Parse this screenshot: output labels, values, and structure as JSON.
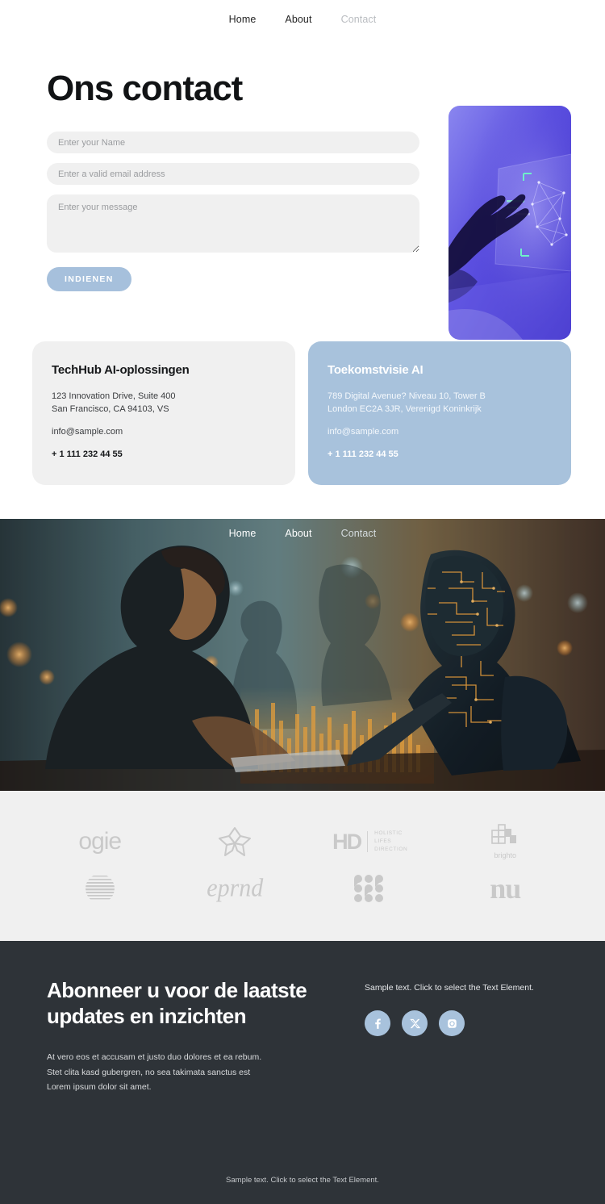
{
  "top_nav": {
    "items": [
      {
        "label": "Home",
        "state": "normal"
      },
      {
        "label": "About",
        "state": "normal"
      },
      {
        "label": "Contact",
        "state": "muted"
      }
    ]
  },
  "contact": {
    "title": "Ons contact",
    "form": {
      "name_placeholder": "Enter your Name",
      "name_value": "",
      "email_placeholder": "Enter a valid email address",
      "email_value": "",
      "message_placeholder": "Enter your message",
      "message_value": "",
      "submit_label": "INDIENEN"
    },
    "hero_image_alt": "hand-touching-holographic-interface"
  },
  "cards": [
    {
      "title": "TechHub AI-oplossingen",
      "address_line1": "123 Innovation Drive, Suite 400",
      "address_line2": "San Francisco, CA 94103, VS",
      "email": "info@sample.com",
      "phone": "+ 1 111 232 44 55",
      "style": "light"
    },
    {
      "title": "Toekomstvisie AI",
      "address_line1": "789 Digital Avenue? Niveau 10, Tower B",
      "address_line2": "London EC2A 3JR, Verenigd Koninkrijk",
      "email": "info@sample.com",
      "phone": "+ 1 111 232 44 55",
      "style": "blue"
    }
  ],
  "banner": {
    "nav": [
      {
        "label": "Home",
        "state": "normal"
      },
      {
        "label": "About",
        "state": "normal"
      },
      {
        "label": "Contact",
        "state": "muted"
      }
    ],
    "image_alt": "woman-working-beside-robot-with-glowing-circuitry"
  },
  "logos": {
    "row1": [
      {
        "name": "ogie-logo",
        "text": "ogie"
      },
      {
        "name": "flower-star-logo",
        "text": ""
      },
      {
        "name": "holistic-lifes-direction-logo",
        "text": "HD",
        "sub1": "HOLISTIC",
        "sub2": "LIFES",
        "sub3": "DIRECTION"
      },
      {
        "name": "brighto-logo",
        "text": "brighto"
      }
    ],
    "row2": [
      {
        "name": "striped-globe-logo",
        "text": ""
      },
      {
        "name": "burla-script-logo",
        "text": "eprnd"
      },
      {
        "name": "dot-pattern-logo",
        "text": ""
      },
      {
        "name": "nu-serif-logo",
        "text": "nu"
      }
    ]
  },
  "footer": {
    "heading": "Abonneer u voor de laatste updates en inzichten",
    "body_line1": "At vero eos et accusam et justo duo dolores et ea rebum.",
    "body_line2": "Stet clita kasd gubergren, no sea takimata sanctus est",
    "body_line3": "Lorem ipsum dolor sit amet.",
    "sample_text": "Sample text. Click to select the Text Element.",
    "socials": [
      {
        "name": "facebook-icon",
        "label": "Facebook"
      },
      {
        "name": "x-twitter-icon",
        "label": "X"
      },
      {
        "name": "instagram-icon",
        "label": "Instagram"
      }
    ],
    "bottom_text": "Sample text. Click to select the Text Element."
  },
  "colors": {
    "accent_blue": "#a8c2dc",
    "footer_bg": "#2e3338",
    "field_bg": "#f0f0f0",
    "logo_gray": "#c9c9c9"
  }
}
